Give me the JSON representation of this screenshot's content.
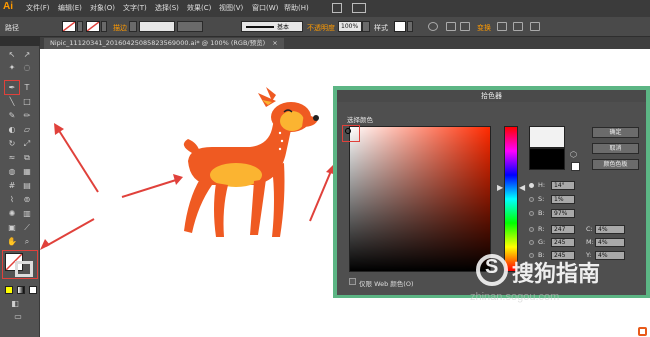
{
  "app": {
    "logo": "Ai"
  },
  "menu": [
    "文件(F)",
    "编辑(E)",
    "对象(O)",
    "文字(T)",
    "选择(S)",
    "效果(C)",
    "视图(V)",
    "窗口(W)",
    "帮助(H)"
  ],
  "control": {
    "selection_label": "路径",
    "stroke_label": "描边",
    "stroke_preset": "基本",
    "opacity_label": "不透明度",
    "opacity_value": "100%",
    "style_label": "样式",
    "transform_label": "变换"
  },
  "tab": {
    "title": "Nipic_11120341_20160425085823569000.ai* @ 100% (RGB/预览)",
    "close": "×"
  },
  "picker": {
    "title": "拾色器",
    "section_label": "选择颜色",
    "buttons": [
      "确定",
      "取消",
      "颜色色板"
    ],
    "hsb": [
      {
        "label": "H:",
        "value": "14°",
        "checked": true
      },
      {
        "label": "S:",
        "value": "1%",
        "checked": false
      },
      {
        "label": "B:",
        "value": "97%",
        "checked": false
      }
    ],
    "rgb": [
      {
        "label": "R:",
        "value": "247"
      },
      {
        "label": "G:",
        "value": "245"
      },
      {
        "label": "B:",
        "value": "245"
      }
    ],
    "cmyk": [
      {
        "label": "C:",
        "value": "4%"
      },
      {
        "label": "M:",
        "value": "4%"
      },
      {
        "label": "Y:",
        "value": "4%"
      }
    ],
    "websafe_label": "仅限 Web 颜色(O)",
    "hue_pointer": "▶"
  },
  "watermark": {
    "text": "搜狗指南",
    "letter": "S",
    "url": "zhinan.sogou.com"
  },
  "colors": {
    "deer_body": "#ef5a22",
    "deer_belly": "#fbb431",
    "arrow": "#e0413b",
    "picker_frame": "#5cb584"
  }
}
